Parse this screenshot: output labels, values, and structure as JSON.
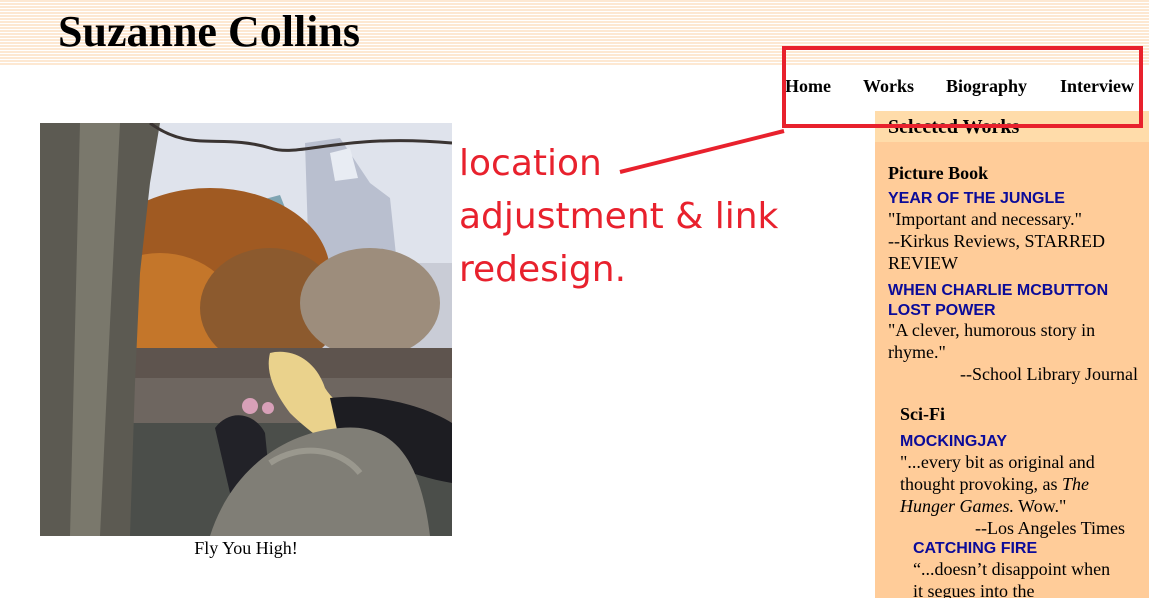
{
  "header": {
    "title": "Suzanne Collins"
  },
  "nav": {
    "items": [
      "Home",
      "Works",
      "Biography",
      "Interview"
    ]
  },
  "photo": {
    "caption": "Fly You High!"
  },
  "annotation": {
    "lines": [
      "location",
      "adjustment & link",
      "redesign."
    ],
    "color": "#e8212d"
  },
  "sidebar": {
    "title": "Selected Works",
    "sections": [
      {
        "heading": "Picture Book",
        "works": [
          {
            "title": "YEAR OF THE JUNGLE",
            "quote": "\"Important and necessary.\"",
            "source": "--Kirkus Reviews, STARRED REVIEW"
          },
          {
            "title": "WHEN CHARLIE MCBUTTON LOST POWER",
            "quote": "\"A clever, humorous story in rhyme.\"",
            "source": "--School Library Journal"
          }
        ]
      },
      {
        "heading": "Sci-Fi",
        "works": [
          {
            "title": "MOCKINGJAY",
            "quote_pre": "\"...every bit as original and thought provoking, as ",
            "quote_em": "The Hunger Games.",
            "quote_post": " Wow.\"",
            "source": "--Los Angeles Times"
          },
          {
            "title": "CATCHING FIRE",
            "quote": "“...doesn’t disappoint when it segues into the"
          }
        ]
      }
    ]
  },
  "colors": {
    "sidebar_bg": "#ffcc99",
    "sidebar_head_bg": "#ffdcaa",
    "link": "#0b0b99",
    "header_stripe": "#fde8d2"
  }
}
